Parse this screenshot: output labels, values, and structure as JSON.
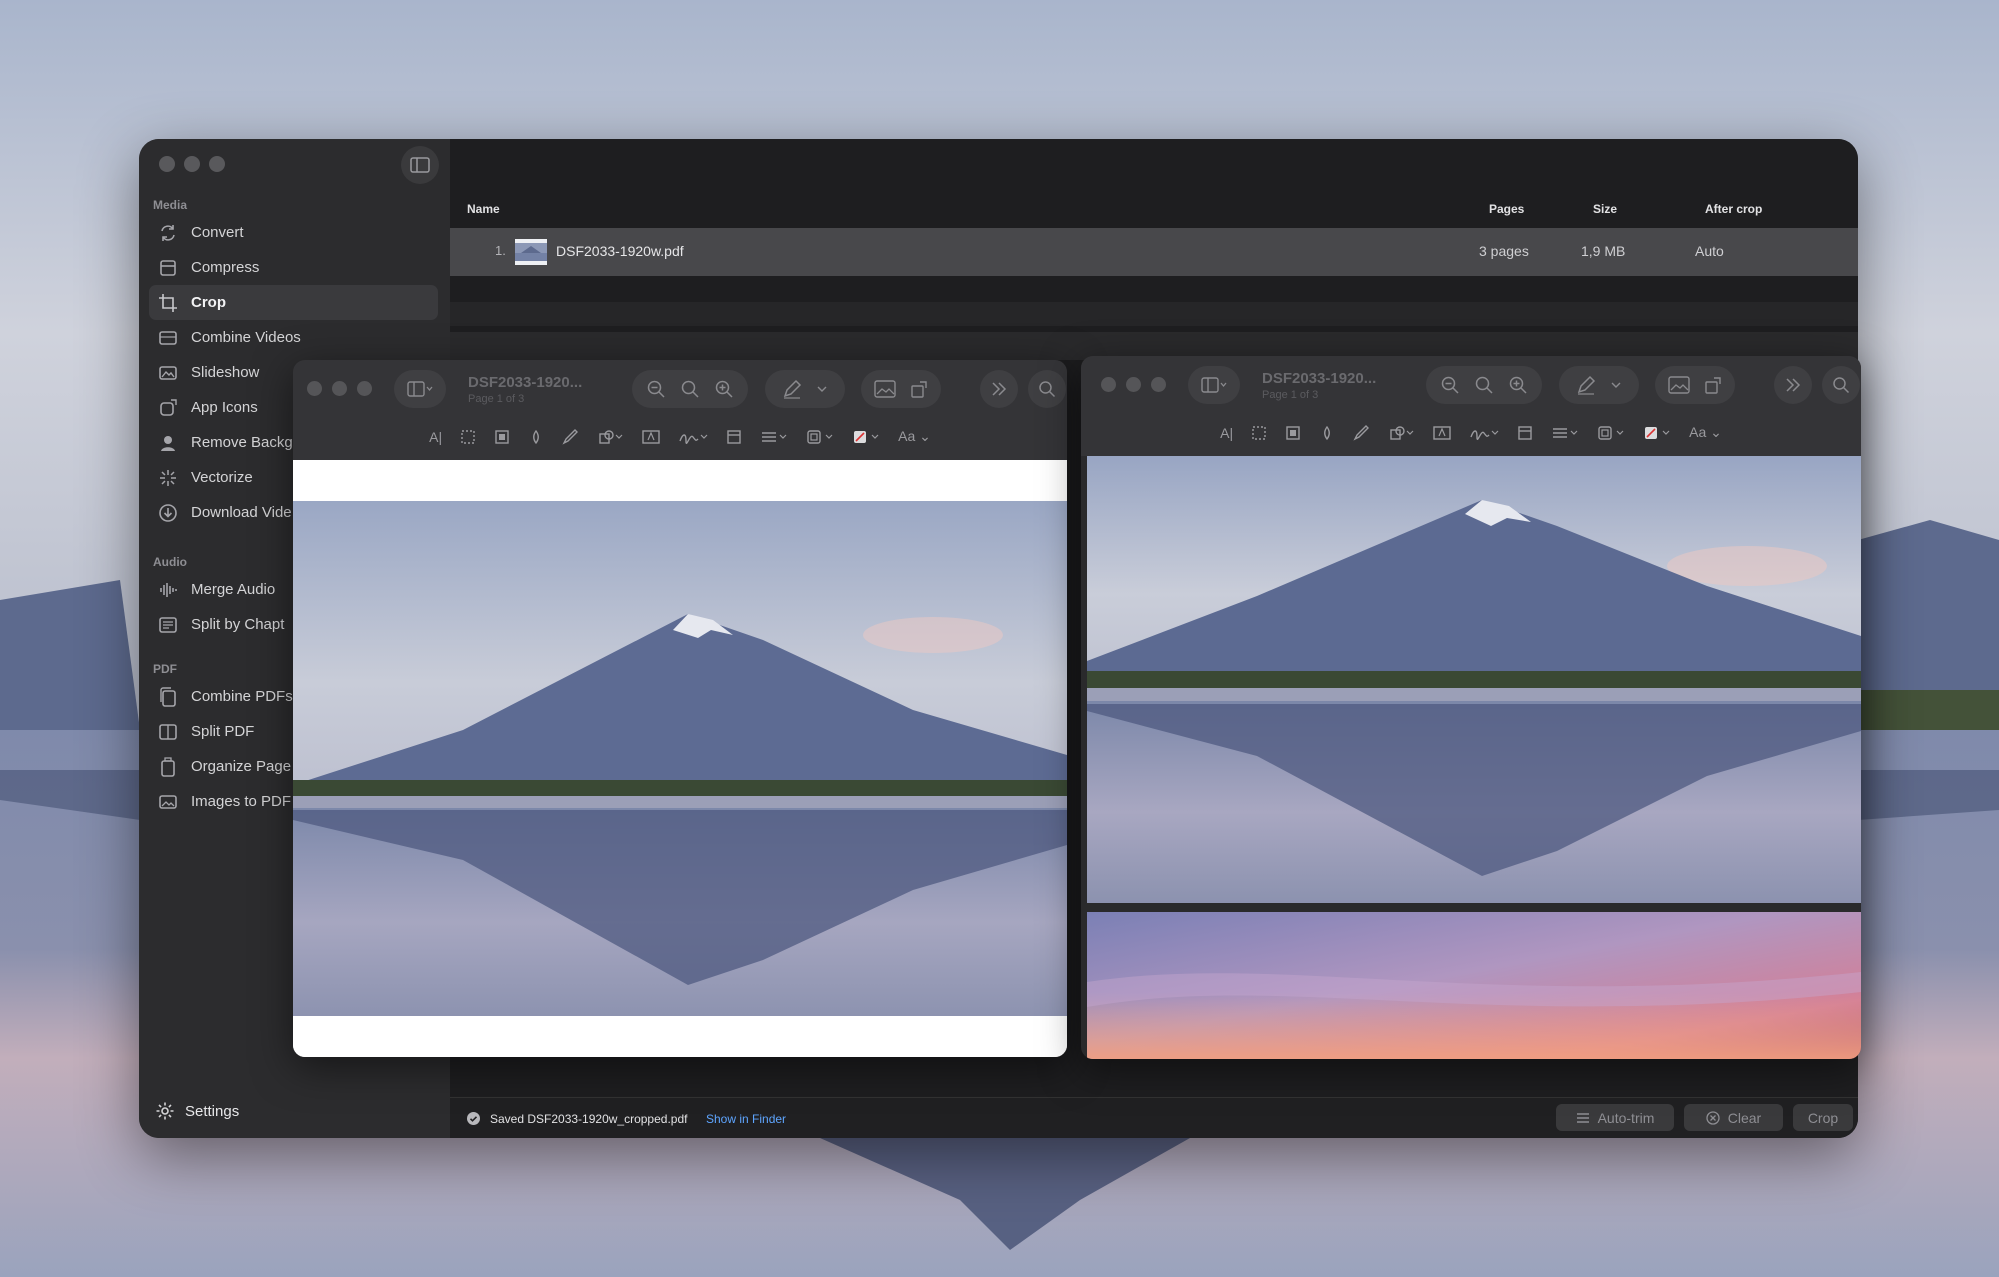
{
  "sidebar": {
    "sections": {
      "media": "Media",
      "audio": "Audio",
      "pdf": "PDF"
    },
    "media_items": [
      {
        "label": "Convert",
        "icon": "convert-icon"
      },
      {
        "label": "Compress",
        "icon": "compress-icon"
      },
      {
        "label": "Crop",
        "icon": "crop-icon",
        "active": true
      },
      {
        "label": "Combine Videos",
        "icon": "combine-videos-icon"
      },
      {
        "label": "Slideshow",
        "icon": "slideshow-icon"
      },
      {
        "label": "App Icons",
        "icon": "app-icons-icon"
      },
      {
        "label": "Remove Backg",
        "icon": "remove-background-icon"
      },
      {
        "label": "Vectorize",
        "icon": "vectorize-icon"
      },
      {
        "label": "Download Vide",
        "icon": "download-icon"
      }
    ],
    "audio_items": [
      {
        "label": "Merge Audio",
        "icon": "waveform-icon"
      },
      {
        "label": "Split by Chapt",
        "icon": "split-chapters-icon"
      }
    ],
    "pdf_items": [
      {
        "label": "Combine PDFs",
        "icon": "combine-pdfs-icon"
      },
      {
        "label": "Split PDF",
        "icon": "split-pdf-icon"
      },
      {
        "label": "Organize Page",
        "icon": "organize-pages-icon"
      },
      {
        "label": "Images to PDF",
        "icon": "images-to-pdf-icon"
      }
    ],
    "settings_label": "Settings"
  },
  "table": {
    "headers": {
      "name": "Name",
      "pages": "Pages",
      "size": "Size",
      "after_crop": "After crop"
    },
    "rows": [
      {
        "index": "1.",
        "name": "DSF2033-1920w.pdf",
        "pages": "3 pages",
        "size": "1,9 MB",
        "after_crop": "Auto"
      }
    ]
  },
  "preview_left": {
    "title": "DSF2033-1920...",
    "page": "Page 1 of 3"
  },
  "preview_right": {
    "title": "DSF2033-1920...",
    "page": "Page 1 of 3"
  },
  "status": {
    "message": "Saved DSF2033-1920w_cropped.pdf",
    "link": "Show in Finder",
    "auto_trim": "Auto-trim",
    "clear": "Clear",
    "crop": "Crop"
  },
  "colors": {
    "window_bg": "#262628",
    "sidebar_bg": "#2c2c2e",
    "row_selected": "#48484b",
    "link": "#5ea5ff"
  }
}
